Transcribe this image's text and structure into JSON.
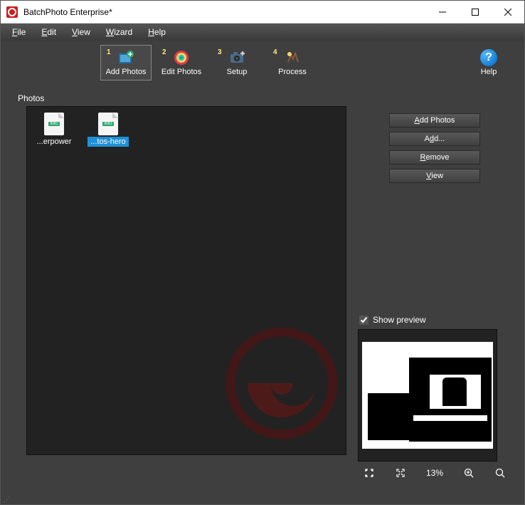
{
  "title": "BatchPhoto Enterprise*",
  "menu": {
    "file": "File",
    "edit": "Edit",
    "view": "View",
    "wizard": "Wizard",
    "help": "Help"
  },
  "toolbar": {
    "add_photos": "Add Photos",
    "edit_photos": "Edit Photos",
    "setup": "Setup",
    "process": "Process",
    "help": "Help",
    "selected": "add_photos",
    "steps": {
      "add_photos": "1",
      "edit_photos": "2",
      "setup": "3",
      "process": "4"
    }
  },
  "photos_label": "Photos",
  "thumbs": [
    {
      "label": "...erpower",
      "selected": false
    },
    {
      "label": "...tos-hero",
      "selected": true
    }
  ],
  "side_buttons": {
    "add_photos": "Add Photos",
    "add": "Add...",
    "remove": "Remove",
    "view": "View"
  },
  "preview": {
    "checkbox_label": "Show preview",
    "checked": true
  },
  "preview_controls": {
    "zoom_percent": "13%"
  }
}
